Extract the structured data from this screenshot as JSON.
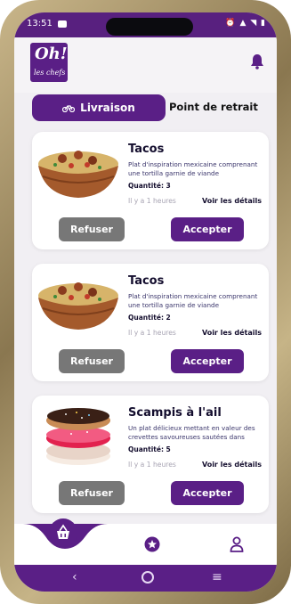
{
  "status_bar": {
    "time": "13:51"
  },
  "logo": {
    "line1": "Oh!",
    "line2": "les chefs"
  },
  "tabs": {
    "delivery": "Livraison",
    "pickup": "Point de retrait"
  },
  "orders": [
    {
      "title": "Tacos",
      "description": "Plat d'inspiration mexicaine comprenant une tortilla garnie de viande",
      "quantity": "Quantité: 3",
      "time_ago": "Il y a 1 heures",
      "details": "Voir les détails",
      "refuse": "Refuser",
      "accept": "Accepter",
      "image": "tacos-bowl"
    },
    {
      "title": "Tacos",
      "description": "Plat d'inspiration mexicaine comprenant une tortilla garnie de viande",
      "quantity": "Quantité: 2",
      "time_ago": "Il y a 1 heures",
      "details": "Voir les détails",
      "refuse": "Refuser",
      "accept": "Accepter",
      "image": "tacos-bowl"
    },
    {
      "title": "Scampis à l'ail",
      "description": "Un plat délicieux mettant en valeur des crevettes savoureuses sautées dans",
      "quantity": "Quantité: 5",
      "time_ago": "Il y a 1 heures",
      "details": "Voir les détails",
      "refuse": "Refuser",
      "accept": "Accepter",
      "image": "donuts-stack"
    }
  ],
  "bottom_nav": {
    "items": [
      "basket-icon",
      "star-icon",
      "user-icon"
    ],
    "active": "basket-icon"
  },
  "colors": {
    "brand": "#5a1f86",
    "refuse": "#777777",
    "background": "#f1eff3"
  }
}
